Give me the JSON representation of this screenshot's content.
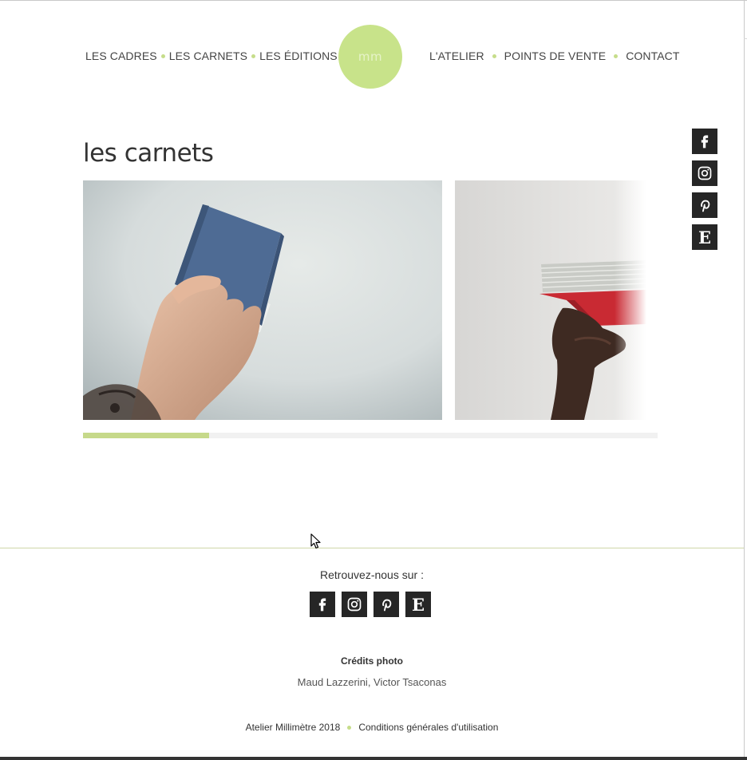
{
  "header": {
    "nav_left": [
      "LES CADRES",
      "LES CARNETS",
      "LES ÉDITIONS"
    ],
    "nav_right": [
      "L'ATELIER",
      "POINTS DE VENTE",
      "CONTACT"
    ],
    "logo_text": "mm",
    "accent_color": "#c8e38a"
  },
  "side_social": [
    "facebook-icon",
    "instagram-icon",
    "pinterest-icon",
    "etsy-icon"
  ],
  "main": {
    "title": "les carnets",
    "gallery": {
      "slides": [
        "hand-holding-blue-notebook",
        "hand-holding-red-notebook"
      ],
      "progress": 0.22
    }
  },
  "footer": {
    "follow_label": "Retrouvez-nous sur :",
    "credits_title": "Crédits photo",
    "credits_names": "Maud Lazzerini, Victor Tsaconas",
    "copyright": "Atelier Millimètre 2018",
    "terms_link": "Conditions générales d'utilisation"
  }
}
